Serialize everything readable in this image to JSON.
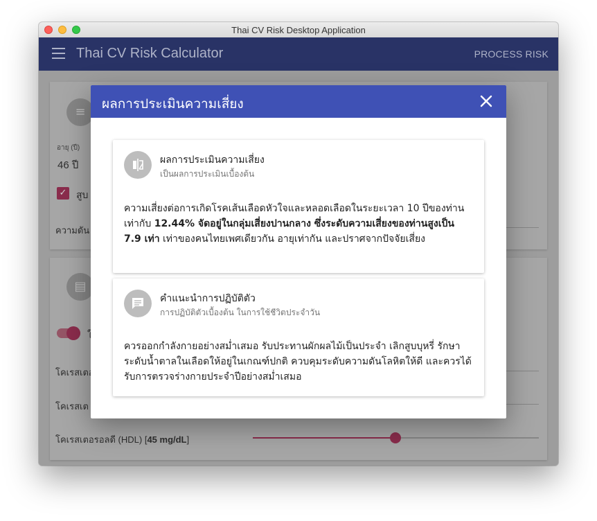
{
  "window": {
    "title": "Thai CV Risk Desktop Application"
  },
  "appbar": {
    "title": "Thai CV Risk Calculator",
    "process_label": "PROCESS RISK"
  },
  "background_form": {
    "age_label": "อายุ (ปี)",
    "age_value": "46 ปี",
    "smoke_label_partial": "สูบ",
    "bp_label_partial": "ความดัน",
    "toggle_label_partial": "ใ",
    "chol1_label_partial": "โคเรสเตอ",
    "chol2_label_partial": "โคเรสเต",
    "hdl_label_prefix": "โคเรสเตอรอลดี (HDL) [",
    "hdl_value": "45 mg/dL",
    "hdl_label_suffix": "]",
    "hdl_slider_fraction": 0.5
  },
  "dialog": {
    "title": "ผลการประเมินความเสี่ยง",
    "close_label": "✕",
    "risk_card": {
      "icon": "compare-icon",
      "title": "ผลการประเมินความเสี่ยง",
      "subtitle": "เป็นผลการประเมินเบื้องต้น",
      "body_intro": "ความเสี่ยงต่อการเกิดโรคเส้นเลือดหัวใจและหลอดเลือดในระยะเวลา 10 ปีของท่านเท่ากับ ",
      "body_bold": "12.44% จัดอยู่ในกลุ่มเสี่ยงปานกลาง ซึ่งระดับความเสี่ยงของท่านสูงเป็น 7.9 เท่า",
      "body_outro": " เท่าของคนไทยเพศเดียวกัน อายุเท่ากัน และปราศจากปัจจัยเสี่ยง"
    },
    "advice_card": {
      "icon": "comment-icon",
      "title": "คำแนะนำการปฏิบัติตัว",
      "subtitle": "การปฏิบัติตัวเบื้องต้น ในการใช้ชีวิตประจำวัน",
      "body": "ควรออกกำลังกายอย่างสม่ำเสมอ รับประทานผักผลไม้เป็นประจำ เลิกสูบบุหรี่ รักษาระดับน้ำตาลในเลือดให้อยู่ในเกณฑ์ปกติ ควบคุมระดับความดันโลหิตให้ดี และควรได้รับการตรวจร่างกายประจำปีอย่างสม่ำเสมอ"
    }
  },
  "colors": {
    "dialog_header": "#3f51b5",
    "appbar": "#293366",
    "accent": "#c2185b"
  }
}
